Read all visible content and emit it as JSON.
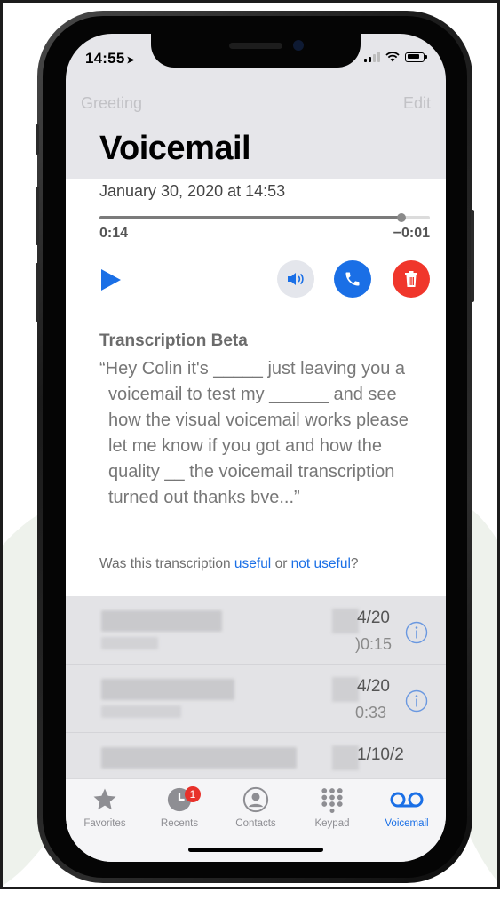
{
  "status_bar": {
    "time": "14:55",
    "location_glyph": "➤"
  },
  "nav": {
    "greeting": "Greeting",
    "edit": "Edit"
  },
  "page": {
    "title": "Voicemail"
  },
  "voicemail": {
    "date": "January 30, 2020 at 14:53",
    "elapsed": "0:14",
    "remaining": "−0:01",
    "progress": 0.915
  },
  "transcription": {
    "title": "Transcription Beta",
    "text": "“Hey Colin it's _____ just leaving you a voicemail to test my ______ and see how the visual voicemail works please let me know if you got and how the quality __ the voicemail transcription turned out thanks bve...”",
    "feedback_prefix": "Was this transcription ",
    "feedback_useful": "useful",
    "feedback_or": " or ",
    "feedback_not_useful": "not useful",
    "feedback_suffix": "?"
  },
  "list": {
    "rows": [
      {
        "date": "4/20",
        "duration": ")0:15"
      },
      {
        "date": "4/20",
        "duration": "0:33"
      },
      {
        "date": "1/10/2"
      }
    ]
  },
  "tabs": [
    {
      "label": "Favorites",
      "icon": "star-icon"
    },
    {
      "label": "Recents",
      "icon": "clock-icon",
      "badge": "1"
    },
    {
      "label": "Contacts",
      "icon": "contact-icon"
    },
    {
      "label": "Keypad",
      "icon": "keypad-icon"
    },
    {
      "label": "Voicemail",
      "icon": "voicemail-icon",
      "active": true
    }
  ],
  "colors": {
    "accent": "#1a6fe6",
    "delete": "#f0362b",
    "badge": "#e8312a"
  }
}
